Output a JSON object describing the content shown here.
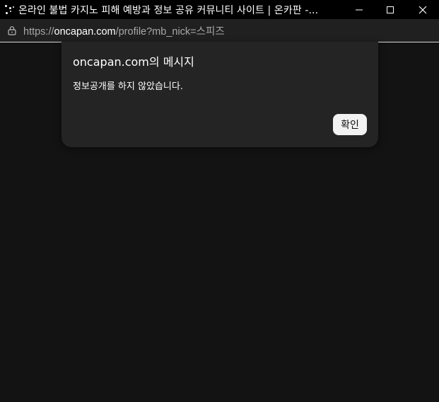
{
  "window": {
    "title": "온라인 불법 카지노 피해 예방과 정보 공유 커뮤니티 사이트 | 온카판 -...",
    "controls": {
      "minimize": "minimize-icon",
      "maximize": "maximize-icon",
      "close": "close-icon"
    }
  },
  "address_bar": {
    "scheme": "https://",
    "domain": "oncapan.com",
    "path": "/profile?mb_nick=스피즈",
    "icon": "lock-icon"
  },
  "dialog": {
    "title": "oncapan.com의 메시지",
    "message": "정보공개를 하지 않았습니다.",
    "ok_label": "확인"
  },
  "colors": {
    "page_background": "#131313",
    "titlebar": "#000000",
    "addressbar": "#202020",
    "dialog_background": "#242424",
    "button_background": "#f2f2f2"
  }
}
